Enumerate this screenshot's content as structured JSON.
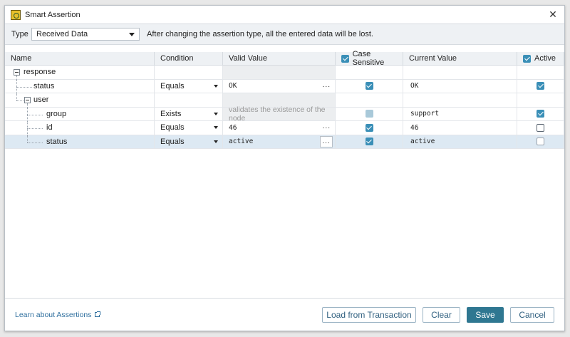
{
  "dialog": {
    "title": "Smart Assertion"
  },
  "typebar": {
    "type_label": "Type",
    "selected_type": "Received Data",
    "warning": "After changing the assertion type, all the entered data will be lost."
  },
  "columns": {
    "name": "Name",
    "condition": "Condition",
    "valid_value": "Valid Value",
    "case_sensitive": "Case Sensitive",
    "current_value": "Current Value",
    "active": "Active"
  },
  "rows": [
    {
      "name": "response",
      "condition": "",
      "valid_value": "",
      "case_sensitive": null,
      "current_value": "",
      "active": null
    },
    {
      "name": "status",
      "condition": "Equals",
      "valid_value": "OK",
      "case_sensitive": true,
      "current_value": "OK",
      "active": true
    },
    {
      "name": "user",
      "condition": "",
      "valid_value": "",
      "case_sensitive": null,
      "current_value": "",
      "active": null
    },
    {
      "name": "group",
      "condition": "Exists",
      "valid_value": "validates the existence of the node",
      "case_sensitive": true,
      "current_value": "support",
      "active": true
    },
    {
      "name": "id",
      "condition": "Equals",
      "valid_value": "46",
      "case_sensitive": true,
      "current_value": "46",
      "active": false
    },
    {
      "name": "status",
      "condition": "Equals",
      "valid_value": "active",
      "case_sensitive": true,
      "current_value": "active",
      "active": false
    }
  ],
  "footer": {
    "learn_link": "Learn about Assertions",
    "load_button": "Load from Transaction",
    "clear_button": "Clear",
    "save_button": "Save",
    "cancel_button": "Cancel"
  },
  "colors": {
    "accent": "#2f7791",
    "checkbox": "#3a8fb7",
    "selected_row": "#dde9f3",
    "link": "#2f6f9e"
  }
}
